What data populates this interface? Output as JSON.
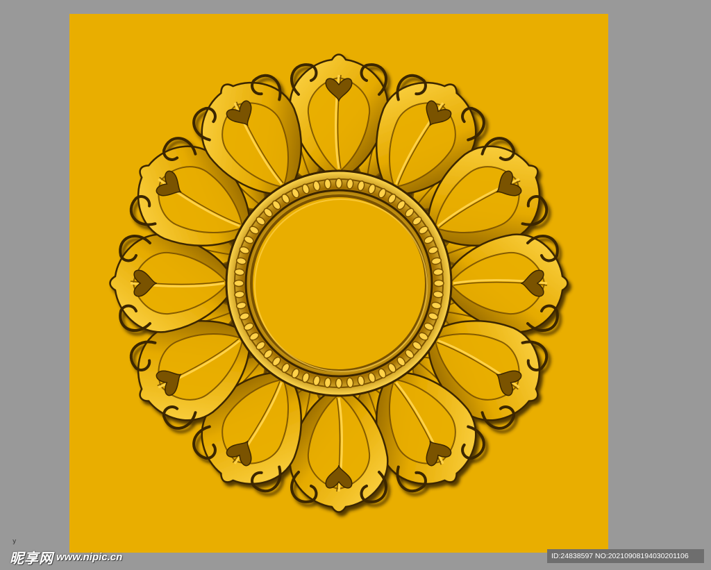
{
  "image": {
    "subject": "golden carved rosette",
    "colors": {
      "background": "#999999",
      "canvas": "#e9ae00",
      "gold_light": "#ffd24a",
      "gold_mid": "#e9ae00",
      "gold_dark": "#7a5200",
      "gold_shadow": "#3b2500"
    },
    "petal_count": 12
  },
  "corner_mark": "y",
  "watermark": {
    "logo_text": "昵享网",
    "url_text": "www.nipic.cn",
    "id_text": "ID:24838597 NO:20210908194030201106"
  }
}
